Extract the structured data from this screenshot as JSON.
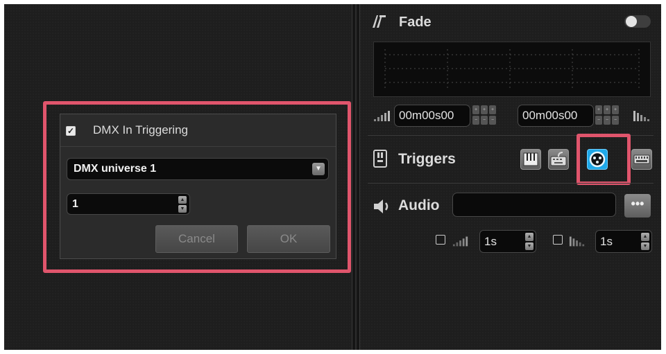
{
  "dialog": {
    "title": "DMX In Triggering",
    "title_checked": true,
    "universe_value": "DMX universe 1",
    "channel_value": "1",
    "cancel_label": "Cancel",
    "ok_label": "OK"
  },
  "fade": {
    "title": "Fade",
    "fade_in_time": "00m00s00",
    "fade_out_time": "00m00s00"
  },
  "triggers": {
    "title": "Triggers",
    "buttons": [
      "piano-keys-icon",
      "keyboard-icon",
      "dmx-connector-icon",
      "midi-keyboard-icon"
    ],
    "active_button": "dmx-connector-icon"
  },
  "audio": {
    "title": "Audio",
    "file_value": "",
    "more_label": "•••",
    "fade_in_value": "1s",
    "fade_out_value": "1s"
  },
  "colors": {
    "highlight": "#e0556c",
    "active_trigger": "#1ea8e8",
    "background": "#1e1e1e"
  }
}
